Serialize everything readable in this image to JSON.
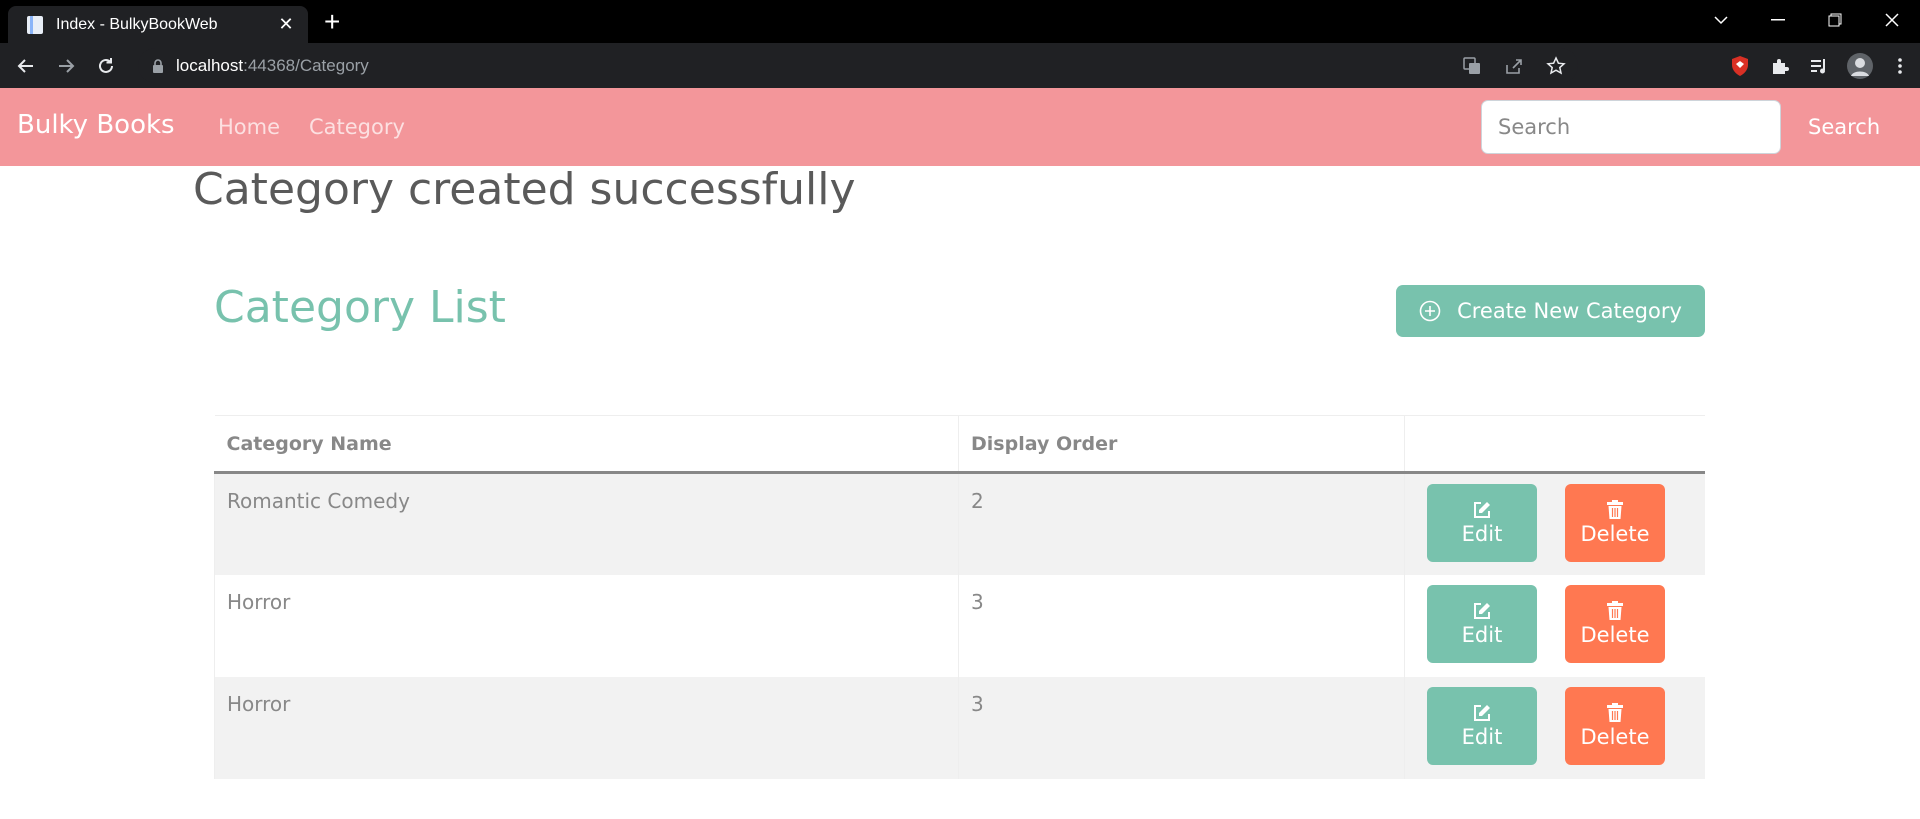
{
  "browser": {
    "tab_title": "Index - BulkyBookWeb",
    "url_host": "localhost",
    "url_rest": ":44368/Category"
  },
  "navbar": {
    "brand": "Bulky Books",
    "links": [
      "Home",
      "Category"
    ],
    "search_placeholder": "Search",
    "search_button": "Search",
    "color": "#f3969a"
  },
  "alert": {
    "message": "Category created successfully"
  },
  "page": {
    "title": "Category List",
    "create_button": "Create New Category",
    "accent": "#78c2ad",
    "danger": "#ff7851"
  },
  "table": {
    "headers": [
      "Category Name",
      "Display Order",
      ""
    ],
    "rows": [
      {
        "name": "Romantic Comedy",
        "order": "2",
        "edit": "Edit",
        "delete": "Delete"
      },
      {
        "name": "Horror",
        "order": "3",
        "edit": "Edit",
        "delete": "Delete"
      },
      {
        "name": "Horror",
        "order": "3",
        "edit": "Edit",
        "delete": "Delete"
      }
    ]
  }
}
